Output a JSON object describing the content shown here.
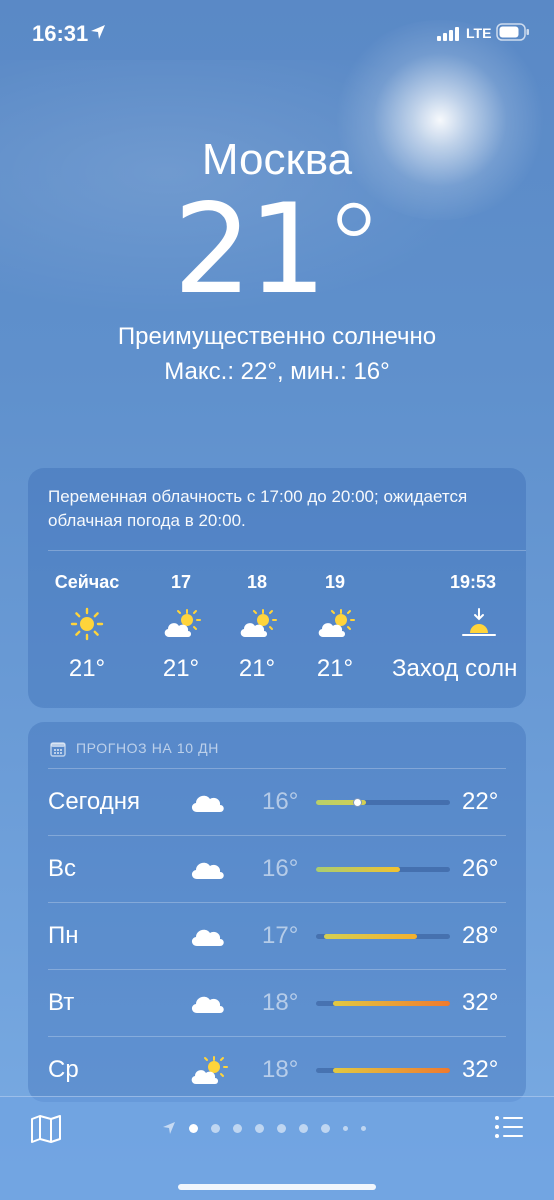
{
  "status_bar": {
    "time": "16:31",
    "network": "LTE"
  },
  "header": {
    "city": "Москва",
    "temperature": "21",
    "condition": "Преимущественно солнечно",
    "high_low": "Макс.: 22°, мин.: 16°"
  },
  "hourly": {
    "summary": "Переменная облачность с 17:00 до 20:00; ожидается облачная погода в 20:00.",
    "items": [
      {
        "label": "Сейчас",
        "icon": "sun-icon",
        "temp": "21°"
      },
      {
        "label": "17",
        "icon": "partly-cloudy-icon",
        "temp": "21°"
      },
      {
        "label": "18",
        "icon": "partly-cloudy-icon",
        "temp": "21°"
      },
      {
        "label": "19",
        "icon": "partly-cloudy-icon",
        "temp": "21°"
      },
      {
        "label": "19:53",
        "icon": "sunset-icon",
        "temp": "Заход солн"
      }
    ]
  },
  "daily": {
    "header": "ПРОГНОЗ НА 10 ДН",
    "range_min": 16,
    "range_max": 32,
    "current_temp": 21,
    "days": [
      {
        "name": "Сегодня",
        "icon": "cloud-icon",
        "low": "16°",
        "high": "22°",
        "low_value": 16,
        "high_value": 22,
        "from_color": "#b8cf6a",
        "to_color": "#d4cf52"
      },
      {
        "name": "Вс",
        "icon": "cloud-icon",
        "low": "16°",
        "high": "26°",
        "low_value": 16,
        "high_value": 26,
        "from_color": "#a9cd72",
        "to_color": "#f2c230"
      },
      {
        "name": "Пн",
        "icon": "cloud-icon",
        "low": "17°",
        "high": "28°",
        "low_value": 17,
        "high_value": 28,
        "from_color": "#d4cf52",
        "to_color": "#f4b02e"
      },
      {
        "name": "Вт",
        "icon": "cloud-icon",
        "low": "18°",
        "high": "32°",
        "low_value": 18,
        "high_value": 32,
        "from_color": "#e2c941",
        "to_color": "#ef7a2e"
      },
      {
        "name": "Ср",
        "icon": "partly-cloudy-icon",
        "low": "18°",
        "high": "32°",
        "low_value": 18,
        "high_value": 32,
        "from_color": "#e2c941",
        "to_color": "#ef7a2e"
      }
    ]
  },
  "pager": {
    "page_count": 8,
    "active_index": 0
  }
}
